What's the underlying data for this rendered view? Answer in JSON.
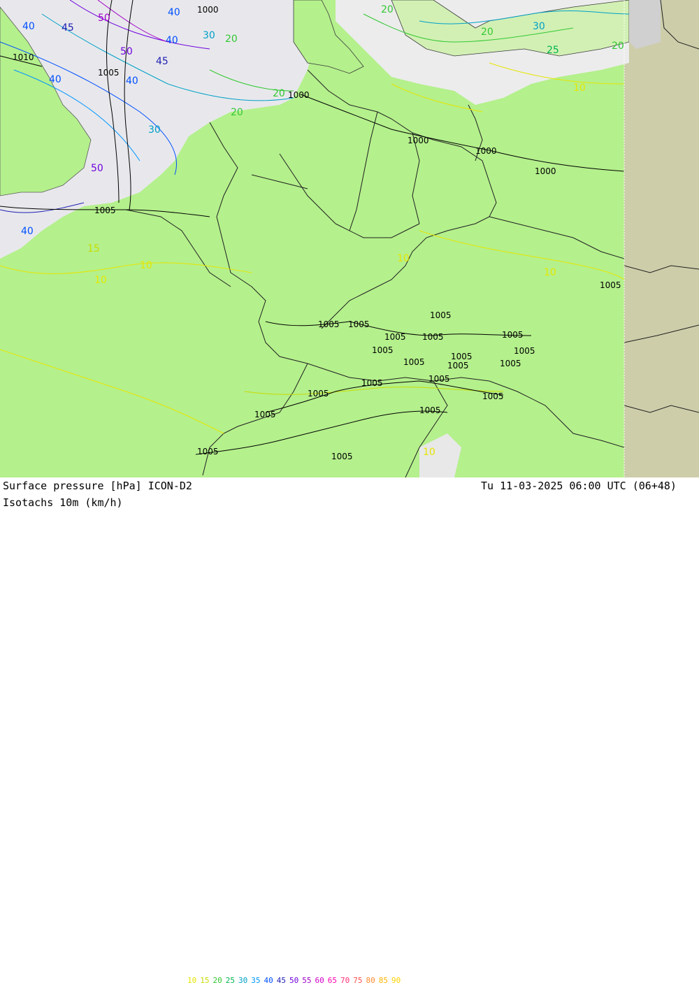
{
  "footer": {
    "title_left": "Surface pressure [hPa] ICON-D2",
    "datetime": "Tu 11-03-2025 06:00 UTC (06+48)",
    "isotachs_label": "Isotachs 10m (km/h)"
  },
  "legend": [
    {
      "value": "10",
      "color": "#e6e600"
    },
    {
      "value": "15",
      "color": "#c8dc00"
    },
    {
      "value": "20",
      "color": "#32c832"
    },
    {
      "value": "25",
      "color": "#00b450"
    },
    {
      "value": "30",
      "color": "#00a0c8"
    },
    {
      "value": "35",
      "color": "#0096ff"
    },
    {
      "value": "40",
      "color": "#0050ff"
    },
    {
      "value": "45",
      "color": "#1e1eb4"
    },
    {
      "value": "50",
      "color": "#6e00dc"
    },
    {
      "value": "55",
      "color": "#a000c8"
    },
    {
      "value": "60",
      "color": "#d200c8"
    },
    {
      "value": "65",
      "color": "#ff00b4"
    },
    {
      "value": "70",
      "color": "#ff3278"
    },
    {
      "value": "75",
      "color": "#ff5050"
    },
    {
      "value": "80",
      "color": "#ff8c32"
    },
    {
      "value": "85",
      "color": "#ffb400"
    },
    {
      "value": "90",
      "color": "#ffd200"
    }
  ],
  "isobar_labels": [
    "1000",
    "1010",
    "1005",
    "1000",
    "1000",
    "1000",
    "1000",
    "1005",
    "1005",
    "1005",
    "1005",
    "1005",
    "1005",
    "1005",
    "1005",
    "1005",
    "1005",
    "1005",
    "1005",
    "1005",
    "1005",
    "1005",
    "1005",
    "1005",
    "1005",
    "1005",
    "1005",
    "1005"
  ],
  "isotach_labels": [
    "50",
    "40",
    "45",
    "50",
    "40",
    "45",
    "40",
    "40",
    "30",
    "30",
    "40",
    "50",
    "40",
    "20",
    "20",
    "20",
    "20",
    "30",
    "25",
    "20",
    "20",
    "10",
    "10",
    "10",
    "10",
    "10",
    "10",
    "15"
  ],
  "colors": {
    "land_green": "#b4f08c",
    "sea_gray": "#e6e6e6",
    "outside_domain": "#cdcdaa",
    "white_zone": "#f0f0f0"
  }
}
